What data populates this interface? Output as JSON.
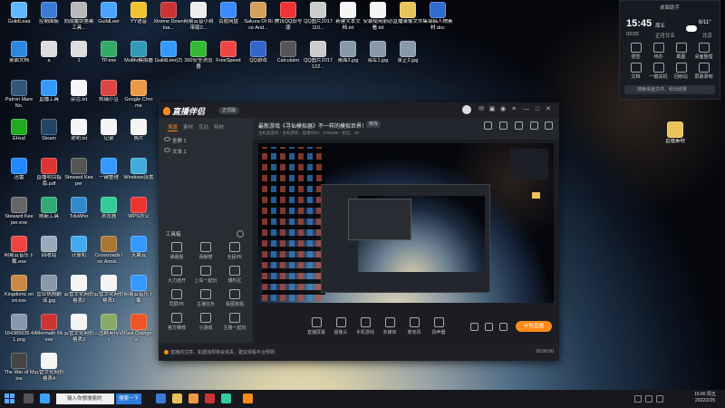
{
  "desktop": {
    "icons": [
      {
        "label": "GuildLeaa",
        "color": "#5fb7ff"
      },
      {
        "label": "控制面板",
        "color": "#3b7bd6"
      },
      {
        "label": "向战魔剑第案工具...",
        "color": "#b8b8b8"
      },
      {
        "label": "GuildLeer",
        "color": "#4aa3ff"
      },
      {
        "label": "YY语音",
        "color": "#f2c12e"
      },
      {
        "label": "Xtreme Downloa...",
        "color": "#c33"
      },
      {
        "label": "网易云音小自带版2...",
        "color": "#eee"
      },
      {
        "label": "百度网盘",
        "color": "#3a8bff"
      },
      {
        "label": "Sakura Of Rice And...",
        "color": "#d4a05a"
      },
      {
        "label": "腾讯QQ旧号版",
        "color": "#e33"
      },
      {
        "label": "QQ图片2017110...",
        "color": "#ccc"
      },
      {
        "label": "新建文本文档.txt",
        "color": "#f5f5f5"
      },
      {
        "label": "安装使用前必看.txt",
        "color": "#f5f5f5"
      },
      {
        "label": "直播录像文件",
        "color": "#e8c25a"
      },
      {
        "label": "集锦稿人物素材.doc",
        "color": "#2f6bd0"
      },
      {
        "label": "桌面文档",
        "color": "#2e86de"
      },
      {
        "label": "a",
        "color": "#ddd"
      },
      {
        "label": "1",
        "color": "#ddd"
      },
      {
        "label": "TP.exe",
        "color": "#3a6"
      },
      {
        "label": "MuMu模拟器",
        "color": "#39b"
      },
      {
        "label": "GuildLeer(2)",
        "color": "#39f"
      },
      {
        "label": "360安全浏览器",
        "color": "#3b3"
      },
      {
        "label": "FreeSpeed",
        "color": "#e44"
      },
      {
        "label": "QQ游戏",
        "color": "#36c"
      },
      {
        "label": "Calculator",
        "color": "#555"
      },
      {
        "label": "QQ图片2017122...",
        "color": "#ccc"
      },
      {
        "label": "桌面2.jpg",
        "color": "#89a"
      },
      {
        "label": "海军1.jpg",
        "color": "#89a"
      },
      {
        "label": "梁正2.jpg",
        "color": "#89a"
      },
      {
        "label": "Patron Mare No.",
        "color": "#357"
      },
      {
        "label": "直播工具",
        "color": "#39f"
      },
      {
        "label": "杂活.txt",
        "color": "#f5f5f5"
      },
      {
        "label": "凯瑞小豆",
        "color": "#d44"
      },
      {
        "label": "Google Chrome",
        "color": "#e94"
      },
      {
        "label": "EHud",
        "color": "#2a2"
      },
      {
        "label": "Steam",
        "color": "#246"
      },
      {
        "label": "说明.txt",
        "color": "#f5f5f5"
      },
      {
        "label": "记录",
        "color": "#f5f5f5"
      },
      {
        "label": "照片",
        "color": "#f5f5f5"
      },
      {
        "label": "迅雷",
        "color": "#28f"
      },
      {
        "label": "直播项目指南.pdf",
        "color": "#d33"
      },
      {
        "label": "Steward Keeper",
        "color": "#555"
      },
      {
        "label": "一键整理",
        "color": "#39f"
      },
      {
        "label": "Windows设置",
        "color": "#4ad"
      },
      {
        "label": "Steward Keeper.exe",
        "color": "#666"
      },
      {
        "label": "刷新工具",
        "color": "#3a7"
      },
      {
        "label": "TdsWho",
        "color": "#38c"
      },
      {
        "label": "浏览器",
        "color": "#3c9"
      },
      {
        "label": "WPS办公",
        "color": "#e33"
      },
      {
        "label": "网易云音乐下载.exe",
        "color": "#e44"
      },
      {
        "label": "回收站",
        "color": "#9ab"
      },
      {
        "label": "计算机",
        "color": "#4ae"
      },
      {
        "label": "Crossroads Inn Anniv...",
        "color": "#a73"
      },
      {
        "label": "天翼云",
        "color": "#39f"
      },
      {
        "label": "Kingdomc onsrt.exe",
        "color": "#c84"
      },
      {
        "label": "营业执照翻译.jpg",
        "color": "#89a"
      },
      {
        "label": "云管文化网价格表2",
        "color": "#f5f5f5"
      },
      {
        "label": "云管文化网价格表1",
        "color": "#f5f5f5"
      },
      {
        "label": "网易云音乐下载",
        "color": "#39f"
      },
      {
        "label": "164385635 41.png",
        "color": "#89a"
      },
      {
        "label": "Aftermath 64.exe",
        "color": "#c33"
      },
      {
        "label": "云管文化网价格表3",
        "color": "#f5f5f5"
      },
      {
        "label": "三国群英传VII",
        "color": "#8a6"
      },
      {
        "label": "Fast Orange.e...",
        "color": "#e52"
      },
      {
        "label": "The War of Mine",
        "color": "#444"
      },
      {
        "label": "云管文化网价格表4",
        "color": "#f5f5f5"
      }
    ]
  },
  "widget": {
    "title": "桌面助手",
    "time": "15:45",
    "weekday": "周五",
    "date": "02/25",
    "lunar": "正月廿五",
    "temp": "6/11°",
    "city": "北京",
    "shortcuts": [
      "便签",
      "待办",
      "截图",
      "桌面整理",
      "文档",
      "一键关机",
      "回收站",
      "屏幕录制"
    ],
    "search_placeholder": "搜索桌面文件、秒出结果"
  },
  "app": {
    "name": "直播伴侣",
    "version": "正式版",
    "left_tabs": [
      "场景",
      "素材",
      "互动",
      "特效"
    ],
    "layers": [
      "全屏 1",
      "文本 1"
    ],
    "tools_title": "工具箱",
    "tools": [
      "弹幕姬",
      "贡献榜",
      "全民PK",
      "大力连开",
      "上车一起玩",
      "爆料区",
      "同屏PK",
      "主播任务",
      "看图答题",
      "官方推荐",
      "小游戏",
      "主播一起玩"
    ],
    "stream_title": "最新游戏《寻仙模拟器》不一样的模拟世界！",
    "edit_label": "修改",
    "stream_meta": "主机类游戏  ·  主机游戏  ·  直播间ID：3788496  ·  粉丝：38",
    "bottom_tools": [
      "直播屏幕",
      "摄像头",
      "手机游戏",
      "多媒体",
      "麦克风",
      "扬声器"
    ],
    "start_label": "开始直播",
    "status_msg": "直播前注意，如遇违规将会追责，建议观看平台规则",
    "status_time": "00:00:00"
  },
  "taskbar": {
    "search_placeholder": "输入你想搜索的",
    "search_button": "搜索一下",
    "time": "15:45 周五",
    "date": "2022/2/25"
  }
}
